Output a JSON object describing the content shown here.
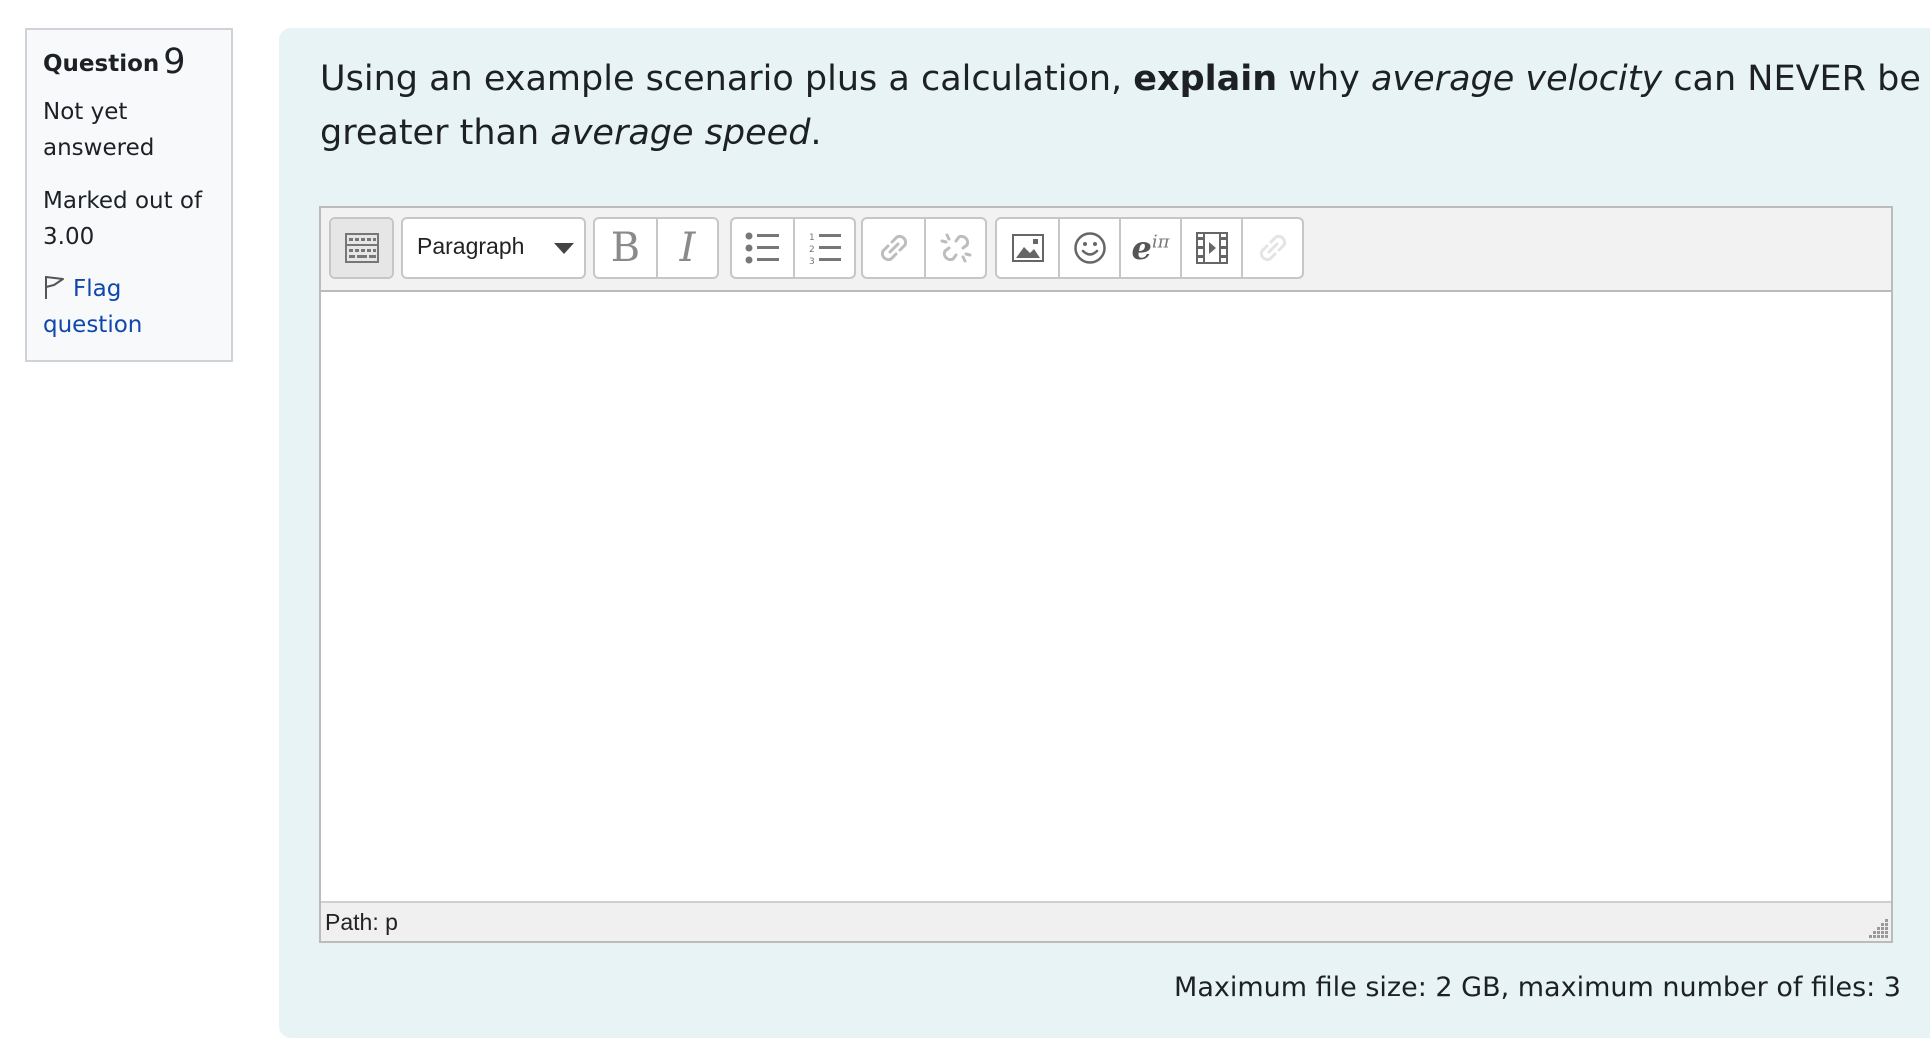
{
  "info": {
    "question_label": "Question",
    "question_number": "9",
    "state": "Not yet answered",
    "grade": "Marked out of 3.00",
    "flag_label": "Flag question"
  },
  "question": {
    "part1": "Using an example scenario plus a calculation, ",
    "bold": "explain",
    "part2": " why ",
    "italic1": "average velocity",
    "part3": " can NEVER be greater than ",
    "italic2": "average speed",
    "part4": "."
  },
  "editor": {
    "paragraph_select": "Paragraph",
    "path": "Path: p",
    "toolbar_icons": [
      "show-more-buttons-icon",
      "bold-icon",
      "italic-icon",
      "unordered-list-icon",
      "ordered-list-icon",
      "link-icon",
      "unlink-icon",
      "image-icon",
      "emoji-icon",
      "equation-icon",
      "media-icon",
      "manage-files-icon"
    ]
  },
  "file_limits": "Maximum file size: 2 GB, maximum number of files: 3",
  "colors": {
    "panel_bg": "#e7f3f5",
    "link": "#0f47ad",
    "info_bg": "#f8f9fa"
  }
}
